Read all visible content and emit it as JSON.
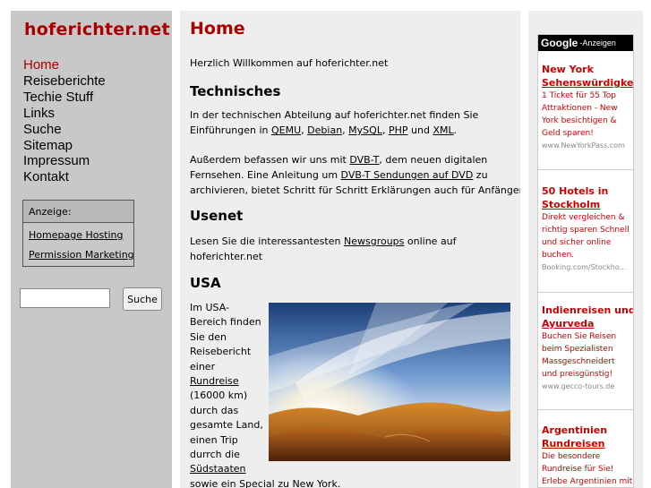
{
  "sidebar": {
    "logo": "hoferichter.net",
    "nav": [
      "Home",
      "Reiseberichte",
      "Techie Stuff",
      "Links",
      "Suche",
      "Sitemap",
      "Impressum",
      "Kontakt"
    ],
    "ad_box": {
      "title": "Anzeige:",
      "links": [
        "Homepage Hosting",
        "Permission Marketing"
      ]
    },
    "search": {
      "value": "",
      "button": "Suche"
    }
  },
  "main": {
    "title": "Home",
    "intro": "Herzlich Willkommen auf hoferichter.net",
    "technisches": {
      "heading": "Technisches",
      "p1_line1": "In der technischen Abteilung auf hoferichter.net finden Sie",
      "p1_pre": "Einführungen in",
      "link_qemu": "QEMU",
      "link_debian": "Debian",
      "link_mysql": "MySQL",
      "link_php": "PHP",
      "and": "und",
      "link_xml": "XML",
      "p2_pre": "Außerdem befassen wir uns mit",
      "link_dvbt": "DVB-T",
      "p2_post": ", dem neuen digitalen",
      "p2_line2_pre": "Fernsehen. Eine Anleitung um",
      "link_dvbt_dvd": "DVB-T Sendungen auf DVD",
      "p2_line2_post": "zu",
      "p2_line3": "archivieren, bietet Schritt für Schritt Erklärungen auch für Anfänger."
    },
    "usenet": {
      "heading": "Usenet",
      "pre": "Lesen Sie die interessantesten",
      "link_newsgroups": "Newsgroups",
      "post": "online auf",
      "line2": "hoferichter.net"
    },
    "usa": {
      "heading": "USA",
      "lines": [
        "Im USA-",
        "Bereich finden",
        "Sie den",
        "Reisebericht",
        "einer"
      ],
      "link_rundreise": "Rundreise",
      "lines2": [
        "(16000 km)",
        "durch das",
        "gesamte Land,",
        "einen Trip",
        "durrch die"
      ],
      "link_suedstaaten": "Südstaaten",
      "last_pre": "sowie ein Special zu",
      "link_newyork": "New York"
    }
  },
  "google_ads": {
    "logo": "Google",
    "label": "-Anzeigen",
    "ads": [
      {
        "title1": "New York",
        "title2": "Sehenswürdigkeite",
        "desc": [
          "1 Ticket für 55 Top",
          "Attraktionen - New",
          "York besichtigen &",
          "Geld sparen!"
        ],
        "url": "www.NewYorkPass.com"
      },
      {
        "title1": "50 Hotels in",
        "title2": "Stockholm",
        "desc": [
          "Direkt vergleichen &",
          "richtig sparen Schnell",
          "und sicher online",
          "buchen."
        ],
        "url": "Booking.com/Stockho..."
      },
      {
        "title1": "Indienreisen und",
        "title2": "Ayurveda",
        "desc": [
          "Buchen Sie Reisen",
          "beim Spezialisten",
          "Massgeschneidert",
          "und preisgünstig!"
        ],
        "url": "www.gecco-tours.de"
      },
      {
        "title1": "Argentinien",
        "title2": "Rundreisen",
        "desc": [
          "Die besondere",
          "Rundreise für Sie!",
          "Erlebe Argentinien mit"
        ],
        "url": ""
      }
    ]
  },
  "colors": {
    "accent": "#aa0000",
    "sidebar_bg": "#c8c8c8",
    "content_bg": "#eeeeee",
    "ad_red": "#cc0000"
  },
  "icons": {
    "photo": "landscape-photo"
  }
}
